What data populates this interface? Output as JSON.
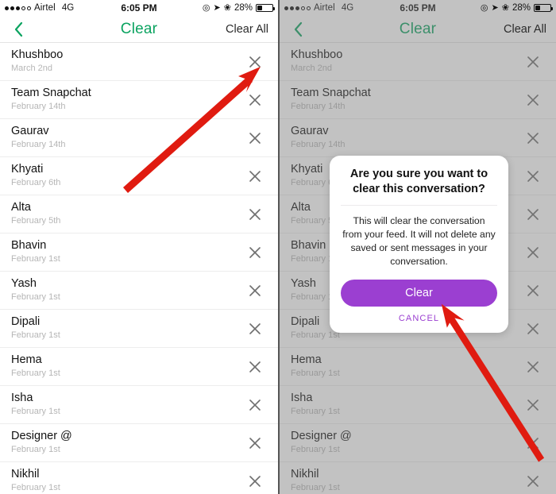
{
  "colors": {
    "accent_green": "#0ba360",
    "accent_purple": "#9b3fd1",
    "arrow_red": "#e01b10",
    "row_date": "#b6b6b6",
    "dim_overlay": "#787878"
  },
  "status_bar": {
    "carrier": "Airtel",
    "network": "4G",
    "time": "6:05 PM",
    "battery_percent": "28%",
    "battery_level": 28,
    "icons": [
      "signal-dots-icon",
      "location-arrow-icon",
      "bluetooth-icon",
      "battery-icon"
    ]
  },
  "nav_bar": {
    "back_icon": "chevron-left-icon",
    "title": "Clear",
    "clear_all_label": "Clear All"
  },
  "conversations": [
    {
      "name": "Khushboo",
      "date": "March 2nd"
    },
    {
      "name": "Team Snapchat",
      "date": "February 14th"
    },
    {
      "name": "Gaurav",
      "date": "February 14th"
    },
    {
      "name": "Khyati",
      "date": "February 6th"
    },
    {
      "name": "Alta",
      "date": "February 5th"
    },
    {
      "name": "Bhavin",
      "date": "February 1st"
    },
    {
      "name": "Yash",
      "date": "February 1st"
    },
    {
      "name": "Dipali",
      "date": "February 1st"
    },
    {
      "name": "Hema",
      "date": "February 1st"
    },
    {
      "name": "Isha",
      "date": "February 1st"
    },
    {
      "name": "Designer @",
      "date": "February 1st"
    },
    {
      "name": "Nikhil",
      "date": "February 1st"
    }
  ],
  "row_close_icon": "close-x-icon",
  "dialog": {
    "title": "Are you sure you want to clear this conversation?",
    "body": "This will clear the conversation from your feed. It will not delete any saved or sent messages in your conversation.",
    "confirm_label": "Clear",
    "cancel_label": "CANCEL"
  },
  "annotations": {
    "left_arrow": "red-arrow-pointing-to-close-icon",
    "right_arrow": "red-arrow-pointing-to-clear-button"
  }
}
